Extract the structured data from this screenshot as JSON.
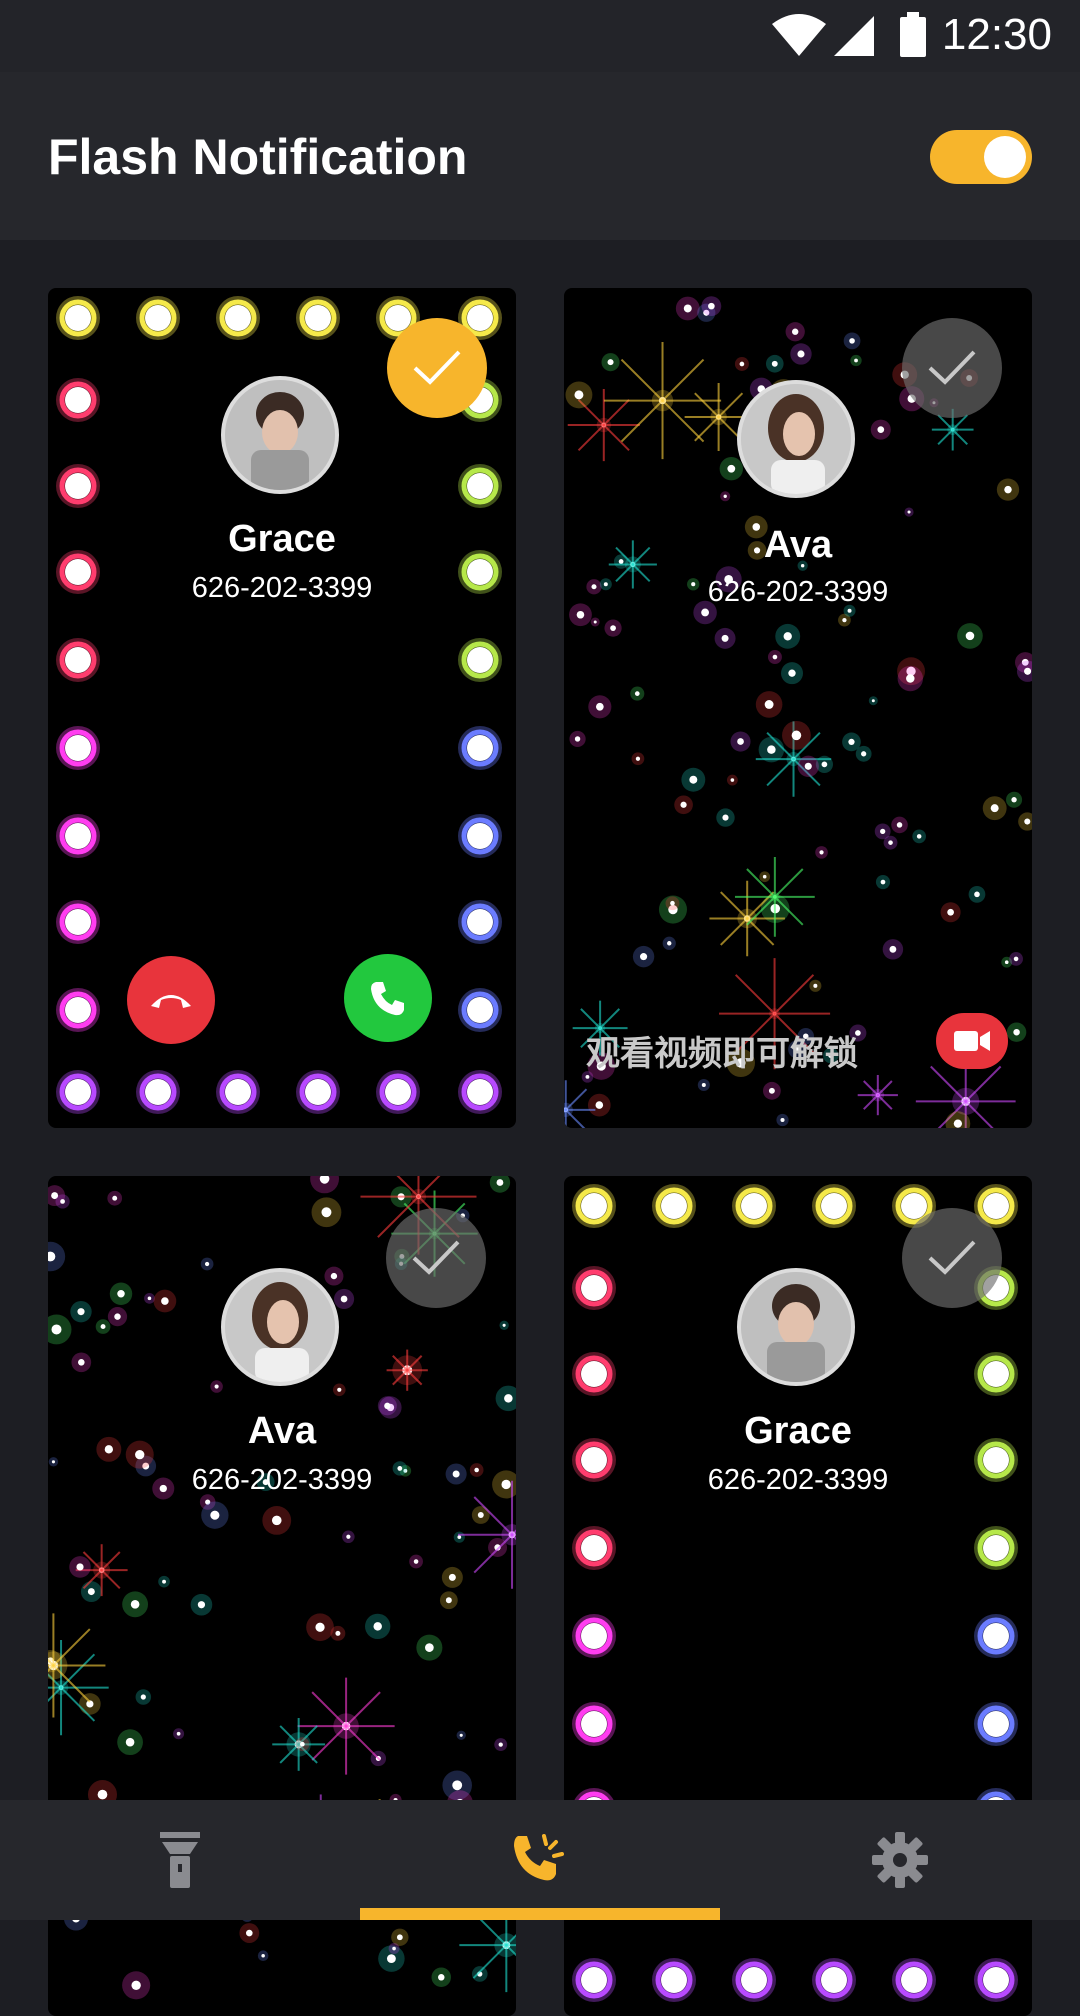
{
  "status_bar": {
    "time": "12:30"
  },
  "header": {
    "title": "Flash Notification",
    "toggle_on": true
  },
  "cards": [
    {
      "theme": "light-bulbs",
      "name": "Grace",
      "number": "626-202-3399",
      "selected": true,
      "show_call_buttons": true
    },
    {
      "theme": "sparkles",
      "name": "Ava",
      "number": "626-202-3399",
      "selected": false,
      "unlock_text": "观看视频即可解锁"
    },
    {
      "theme": "sparkles",
      "name": "Ava",
      "number": "626-202-3399",
      "selected": false
    },
    {
      "theme": "light-bulbs",
      "name": "Grace",
      "number": "626-202-3399",
      "selected": false
    }
  ],
  "bottom_nav": {
    "items": [
      {
        "icon": "flashlight-icon",
        "active": false
      },
      {
        "icon": "phone-flash-icon",
        "active": true
      },
      {
        "icon": "gear-icon",
        "active": false
      }
    ]
  },
  "colors": {
    "accent": "#f7b52c",
    "background": "#1d1e23",
    "decline": "#e8343c",
    "accept": "#22c83e"
  }
}
